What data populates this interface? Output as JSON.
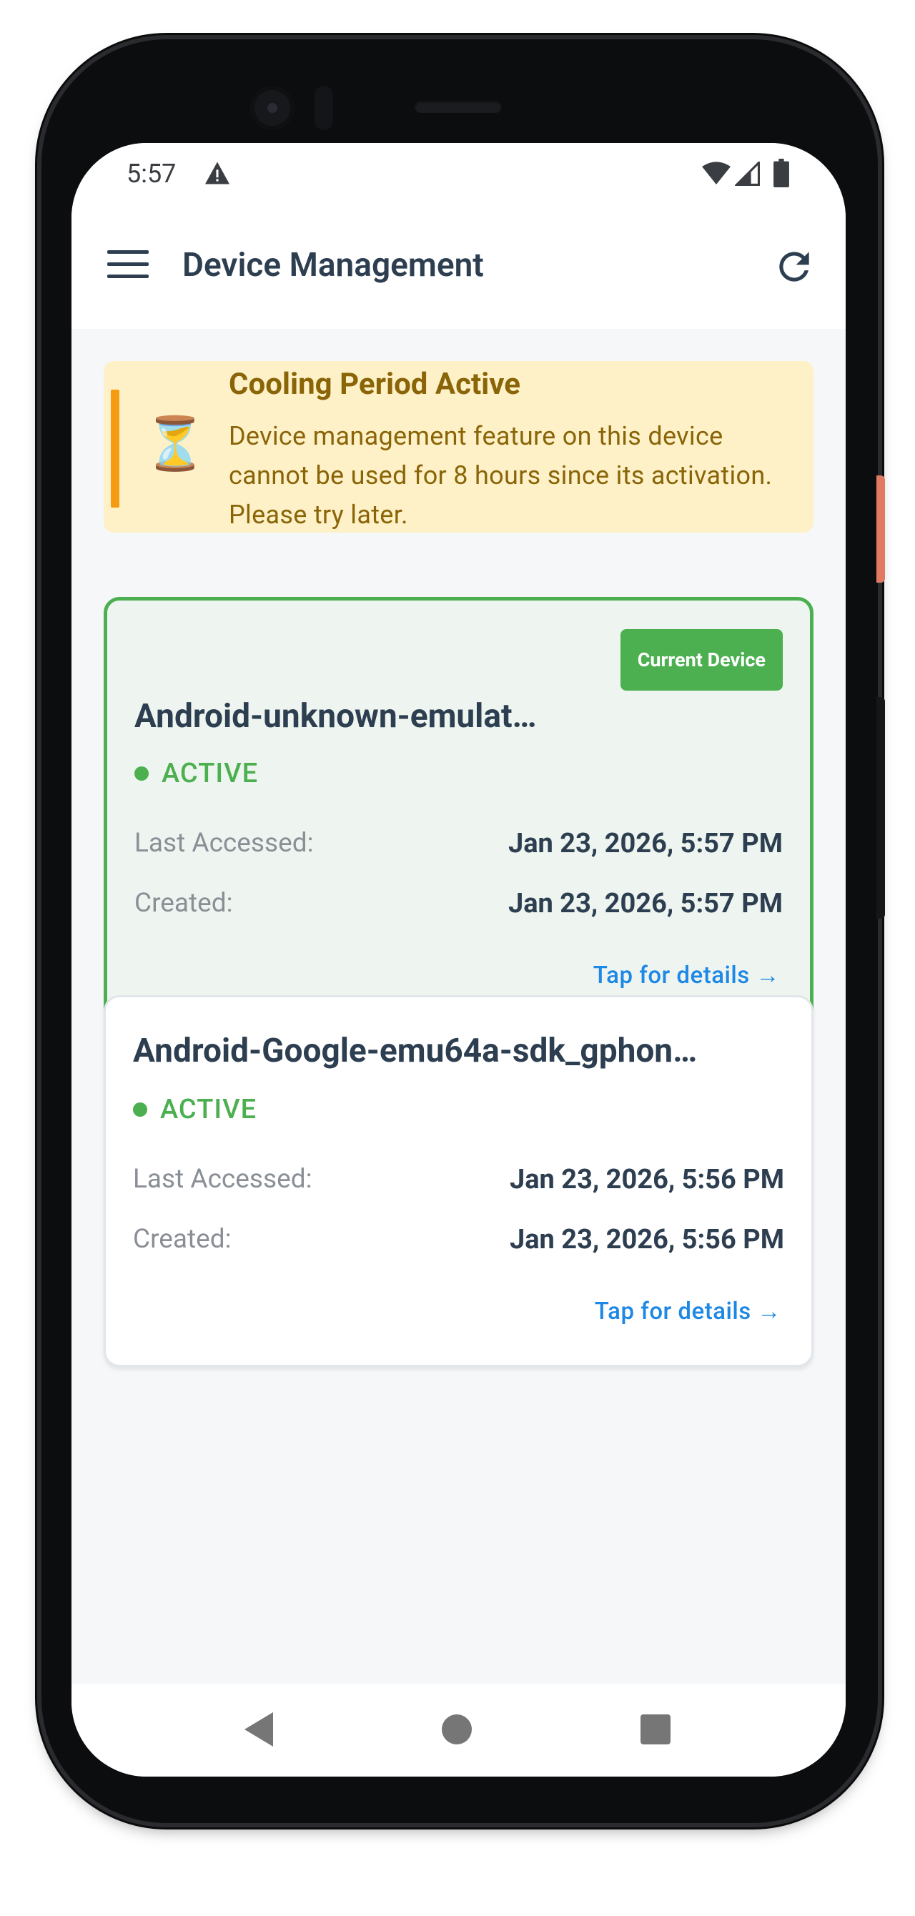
{
  "status_bar": {
    "time": "5:57",
    "icons": [
      "warning-icon",
      "wifi-icon",
      "signal-icon",
      "battery-icon"
    ]
  },
  "app_bar": {
    "title": "Device Management",
    "menu_icon": "menu-icon",
    "refresh_icon": "refresh-icon"
  },
  "banner": {
    "icon": "⏳",
    "title": "Cooling Period Active",
    "message": "Device management feature on this device cannot be used for 8 hours since its activation. Please try later.",
    "accent_color": "#f39c12",
    "background_color": "#fef1c8"
  },
  "devices": [
    {
      "name": "Android-unknown-emulat…",
      "badge": "Current Device",
      "status": "ACTIVE",
      "last_accessed_label": "Last Accessed:",
      "last_accessed": "Jan 23, 2026, 5:57 PM",
      "created_label": "Created:",
      "created": "Jan 23, 2026, 5:57 PM",
      "details_link": "Tap for details →"
    },
    {
      "name": "Android-Google-emu64a-sdk_gphon…",
      "status": "ACTIVE",
      "last_accessed_label": "Last Accessed:",
      "last_accessed": "Jan 23, 2026, 5:56 PM",
      "created_label": "Created:",
      "created": "Jan 23, 2026, 5:56 PM",
      "details_link": "Tap for details →"
    }
  ],
  "colors": {
    "status_active": "#4caf50",
    "link": "#1e88e5",
    "title": "#2c3e50"
  },
  "nav_bar": {
    "icons": [
      "back-icon",
      "home-icon",
      "recents-icon"
    ]
  }
}
